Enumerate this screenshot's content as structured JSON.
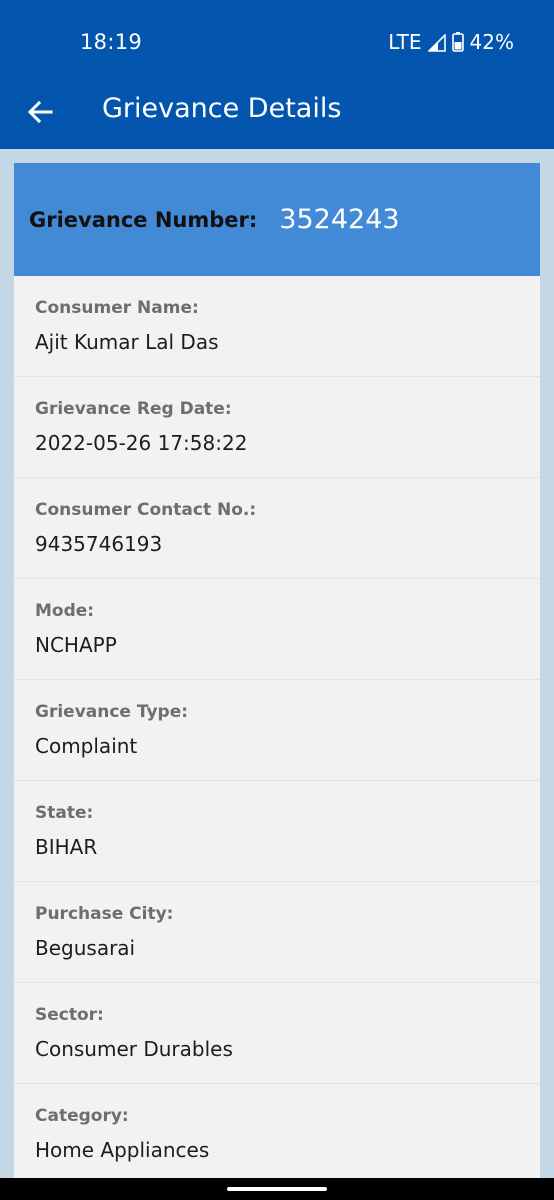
{
  "status_bar": {
    "time": "18:19",
    "network": "LTE",
    "battery": "42%"
  },
  "app_bar": {
    "title": "Grievance Details"
  },
  "grievance": {
    "number_label": "Grievance Number:",
    "number_value": "3524243"
  },
  "fields": [
    {
      "label": "Consumer Name:",
      "value": "Ajit Kumar Lal Das"
    },
    {
      "label": "Grievance Reg Date:",
      "value": "2022-05-26 17:58:22"
    },
    {
      "label": "Consumer Contact No.:",
      "value": "9435746193"
    },
    {
      "label": "Mode:",
      "value": "NCHAPP"
    },
    {
      "label": "Grievance Type:",
      "value": "Complaint"
    },
    {
      "label": "State:",
      "value": "BIHAR"
    },
    {
      "label": "Purchase City:",
      "value": "Begusarai"
    },
    {
      "label": "Sector:",
      "value": "Consumer Durables"
    },
    {
      "label": "Category:",
      "value": "Home Appliances"
    }
  ],
  "colors": {
    "app_bar": "#0455ad",
    "header_card": "#4289d6",
    "background": "#c3d7e4",
    "card": "#f2f2f2"
  },
  "icons": {
    "back": "arrow-left-icon",
    "signal": "signal-icon",
    "battery": "battery-icon"
  }
}
